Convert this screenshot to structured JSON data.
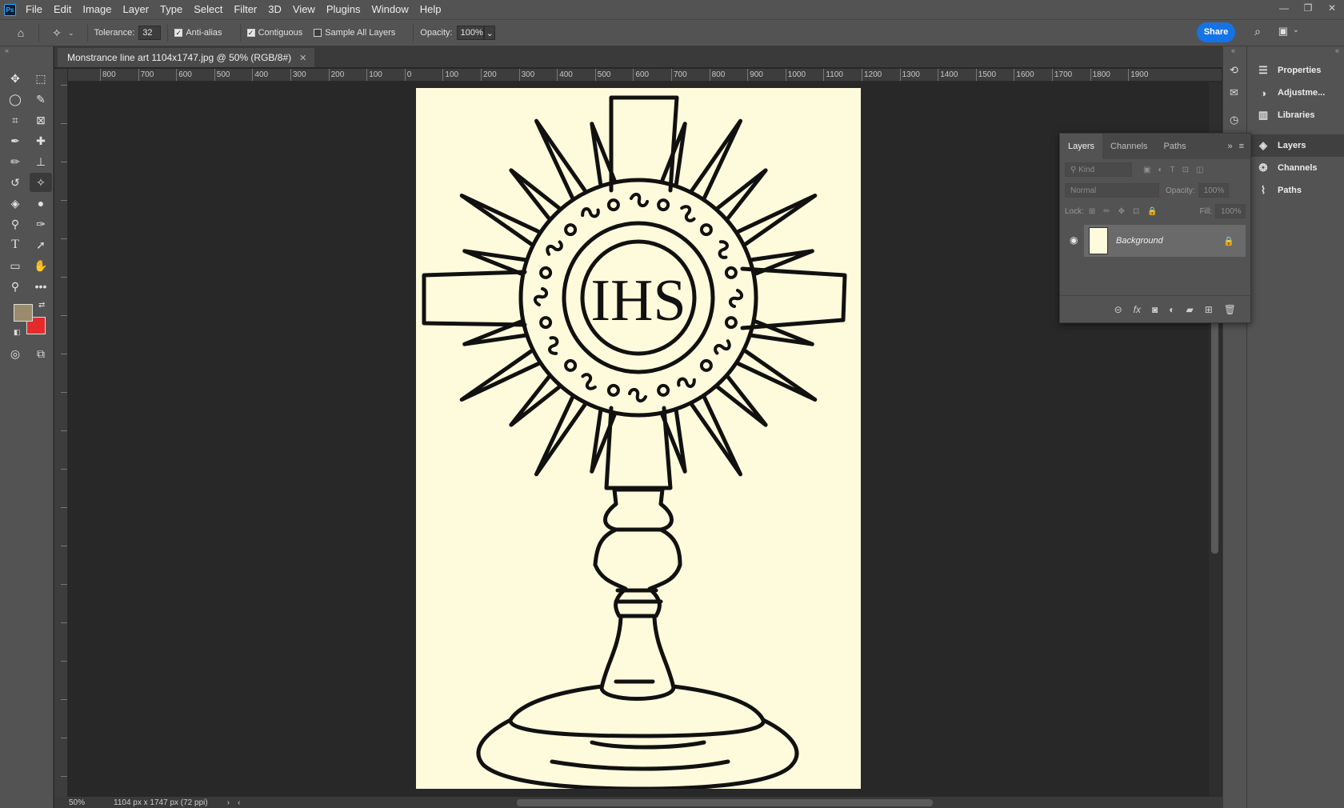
{
  "app": {
    "logo": "Ps"
  },
  "menu": [
    "File",
    "Edit",
    "Image",
    "Layer",
    "Type",
    "Select",
    "Filter",
    "3D",
    "View",
    "Plugins",
    "Window",
    "Help"
  ],
  "options": {
    "tolerance_label": "Tolerance:",
    "tolerance_value": "32",
    "anti_alias": "Anti-alias",
    "contiguous": "Contiguous",
    "sample_all_layers": "Sample All Layers",
    "opacity_label": "Opacity:",
    "opacity_value": "100%",
    "share": "Share"
  },
  "document": {
    "tab_title": "Monstrance line art 1104x1747.jpg @ 50% (RGB/8#)",
    "zoom": "50%",
    "size_info": "1104 px x 1747 px (72 ppi)",
    "monogram": "IHS"
  },
  "ruler": {
    "h_labels": [
      "800",
      "700",
      "600",
      "500",
      "400",
      "300",
      "200",
      "100",
      "0",
      "100",
      "200",
      "300",
      "400",
      "500",
      "600",
      "700",
      "800",
      "900",
      "1000",
      "1100",
      "1200",
      "1300",
      "1400",
      "1500",
      "1600",
      "1700",
      "1800",
      "1900"
    ]
  },
  "colors": {
    "foreground": "#9c8a6c",
    "background": "#e42a2a",
    "share_blue": "#1473e6",
    "paper": "#fefbdc"
  },
  "right_dock": {
    "items": [
      {
        "label": "Properties",
        "icon": "sliders-icon"
      },
      {
        "label": "Adjustme...",
        "icon": "adjustments-icon"
      },
      {
        "label": "Libraries",
        "icon": "libraries-icon"
      },
      {
        "label": "Layers",
        "icon": "layers-icon"
      },
      {
        "label": "Channels",
        "icon": "channels-icon"
      },
      {
        "label": "Paths",
        "icon": "paths-icon"
      }
    ]
  },
  "layers_panel": {
    "tabs": [
      "Layers",
      "Channels",
      "Paths"
    ],
    "kind_placeholder": "Kind",
    "blend_mode": "Normal",
    "opacity_label": "Opacity:",
    "opacity_value": "100%",
    "lock_label": "Lock:",
    "fill_label": "Fill:",
    "fill_value": "100%",
    "layer_name": "Background"
  }
}
